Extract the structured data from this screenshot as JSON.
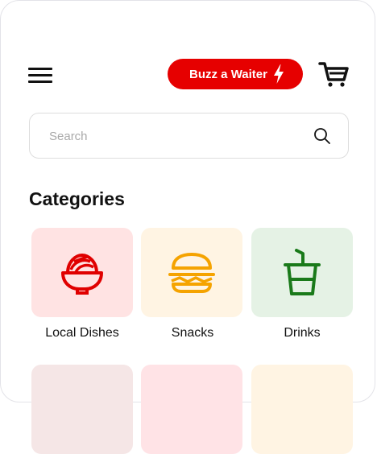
{
  "header": {
    "buzz_label": "Buzz a Waiter",
    "buzz_color": "#e60000",
    "menu_icon": "hamburger-icon",
    "buzz_icon": "lightning-icon",
    "cart_icon": "cart-icon"
  },
  "search": {
    "placeholder": "Search",
    "icon": "search-icon"
  },
  "categories": {
    "title": "Categories",
    "items": [
      {
        "label": "Local Dishes",
        "icon": "noodle-bowl-icon",
        "bg": "#ffe3e3",
        "color": "#e00000"
      },
      {
        "label": "Snacks",
        "icon": "burger-icon",
        "bg": "#fff4e3",
        "color": "#f5a300"
      },
      {
        "label": "Drinks",
        "icon": "cup-straw-icon",
        "bg": "#e5f2e5",
        "color": "#1a7a1a"
      }
    ],
    "more_tile_colors": [
      "#f5e6e6",
      "#ffe3e6",
      "#fff4e3"
    ]
  }
}
